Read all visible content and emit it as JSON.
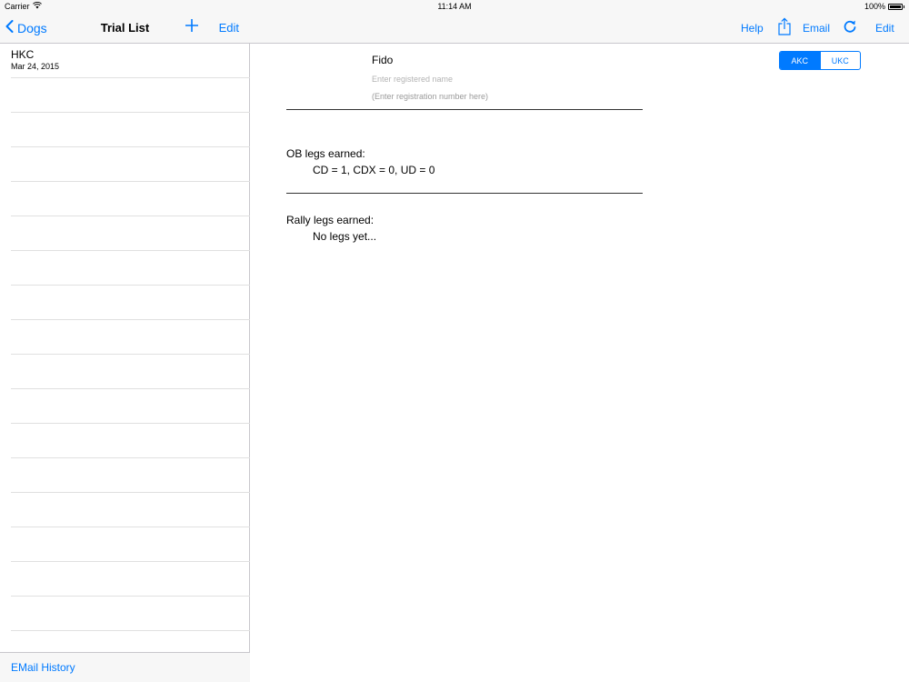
{
  "status": {
    "carrier": "Carrier",
    "time": "11:14 AM",
    "battery": "100%"
  },
  "master": {
    "back_label": "Dogs",
    "title": "Trial List",
    "edit_label": "Edit",
    "trials": [
      {
        "name": "HKC",
        "date": "Mar 24, 2015"
      }
    ],
    "empty_rows": 16,
    "footer_label": "EMail History"
  },
  "detail": {
    "nav": {
      "help": "Help",
      "email": "Email",
      "edit": "Edit"
    },
    "dog_name": "Fido",
    "registered_name_placeholder": "Enter registered name",
    "registration_number_placeholder": "(Enter registration number here)",
    "registry": {
      "options": [
        "AKC",
        "UKC"
      ],
      "selected": "AKC"
    },
    "ob": {
      "title": "OB legs earned:",
      "legs": "CD = 1, CDX = 0, UD = 0"
    },
    "rally": {
      "title": "Rally legs earned:",
      "legs": "No legs yet..."
    }
  },
  "colors": {
    "accent": "#007aff",
    "bar": "#f7f7f7",
    "separator": "#c8c7cc"
  }
}
